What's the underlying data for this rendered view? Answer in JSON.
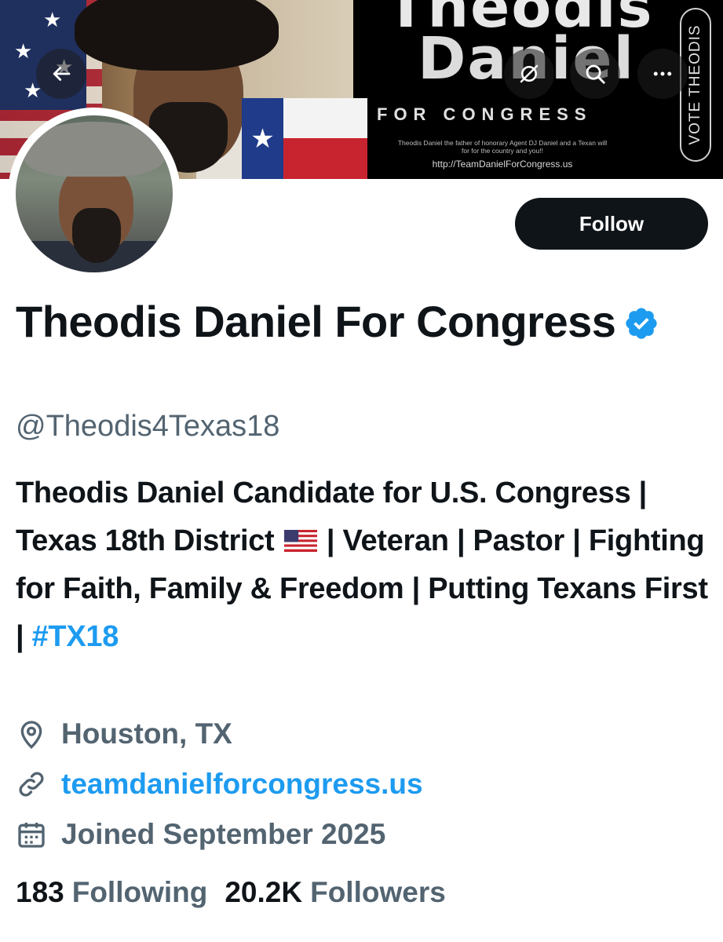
{
  "banner": {
    "title_line1": "Theodis",
    "title_line2": "Daniel",
    "subtitle": "FOR CONGRESS",
    "small_text": "Theodis Daniel the father of honorary Agent DJ Daniel and a Texan will for for the country and you!!",
    "url": "http://TeamDanielForCongress.us",
    "vote_text": "VOTE THEODIS"
  },
  "header_buttons": {
    "back_icon": "arrow-left-icon",
    "search_icon": "search-icon",
    "more_icon": "more-icon",
    "more_label": "···"
  },
  "follow_button": {
    "label": "Follow"
  },
  "profile": {
    "display_name": "Theodis Daniel For Congress",
    "verified": true,
    "handle": "@Theodis4Texas18",
    "bio_part1": "Theodis Daniel Candidate for U.S. Congress | Texas 18th District ",
    "bio_part2": " | Veteran | Pastor | Fighting for Faith, Family & Freedom | Putting Texans First | ",
    "bio_hashtag": "#TX18",
    "location": "Houston, TX",
    "website": "teamdanielforcongress.us",
    "joined": "Joined September 2025"
  },
  "stats": {
    "following_count": "183",
    "following_label": "Following",
    "followers_count": "20.2K",
    "followers_label": "Followers"
  },
  "colors": {
    "accent": "#1d9bf0",
    "text": "#0f1419",
    "secondary": "#536471",
    "button": "#0f1419"
  }
}
